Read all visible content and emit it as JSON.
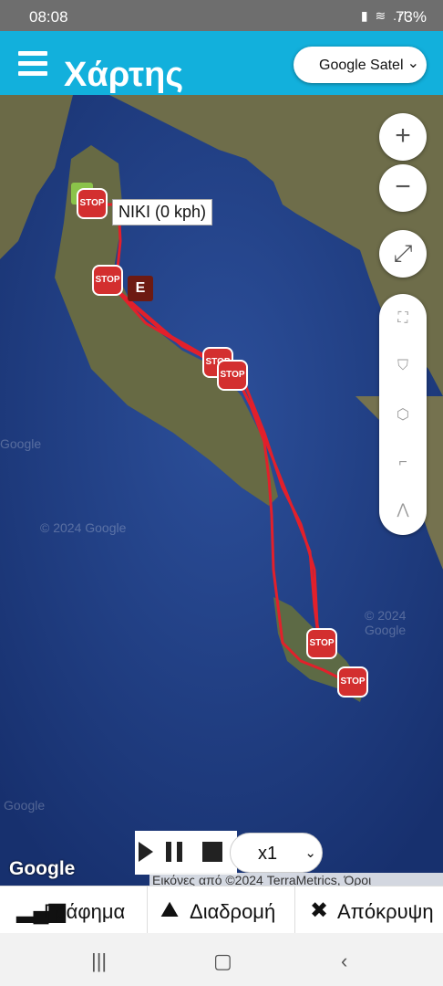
{
  "status_bar": {
    "time": "08:08",
    "battery": "73%"
  },
  "app_bar": {
    "title": "Χάρτης",
    "map_type": "Google Satellite"
  },
  "map": {
    "vehicle_label": "NIKI (0 kph)",
    "stop_label": "STOP",
    "end_marker_label": "E",
    "watermark": "© 2024 Google",
    "watermark_short": "Google",
    "google_logo": "Google",
    "attribution": "Εικόνες από ©2024 TerraMetrics, Όροι"
  },
  "controls": {
    "zoom_in": "+",
    "zoom_out": "−"
  },
  "playback": {
    "speed": "x1"
  },
  "tabs": [
    {
      "label": "Γράφημα"
    },
    {
      "label": "Διαδρομή"
    },
    {
      "label": "Απόκρυψη"
    }
  ],
  "colors": {
    "app_bar": "#12b0dc",
    "route": "#e2202b",
    "stop_marker": "#d32f2f",
    "end_marker": "#6d1a12",
    "start_marker": "#8bc34a"
  }
}
